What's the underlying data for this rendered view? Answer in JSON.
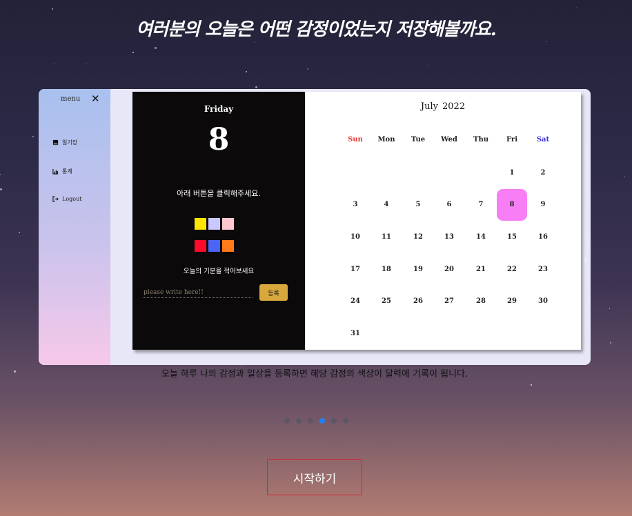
{
  "headline": "여러분의 오늘은 어떤 감정이었는지 저장해볼까요.",
  "slider": {
    "prev_icon": "chevron-left-icon",
    "next_icon": "chevron-right-icon"
  },
  "sidebar": {
    "menu_label": "menu",
    "close_icon": "close-icon",
    "items": [
      {
        "label": "일기장",
        "icon": "book-icon"
      },
      {
        "label": "통계",
        "icon": "chart-icon"
      },
      {
        "label": "Logout",
        "icon": "logout-icon"
      }
    ]
  },
  "diary": {
    "weekday": "Friday",
    "day": "8",
    "instruction": "아래 버튼을 클릭해주세요.",
    "colors": [
      "#ffe600",
      "#c8c8ff",
      "#ffc8cf",
      "#ff0a2a",
      "#4a64f5",
      "#ff7a18"
    ],
    "mood_label": "오늘의 기분을 적어보세요",
    "input_placeholder": "please write here!!",
    "register_label": "등록"
  },
  "calendar": {
    "month": "July",
    "year": "2022",
    "weekdays": [
      "Sun",
      "Mon",
      "Tue",
      "Wed",
      "Thu",
      "Fri",
      "Sat"
    ],
    "weekday_colors": {
      "Sun": "#e53935",
      "Sat": "#3a2fd6"
    },
    "first_weekday_index": 5,
    "days_in_month": 31,
    "selected_day": 8,
    "selected_color": "#f77ef5"
  },
  "caption": "오늘 하루 나의 감정과 일상을 등록하면 해당 감정의 색상이 달력에 기록이 됩니다.",
  "pagination": {
    "count": 6,
    "active_index": 3
  },
  "start_button": "시작하기"
}
